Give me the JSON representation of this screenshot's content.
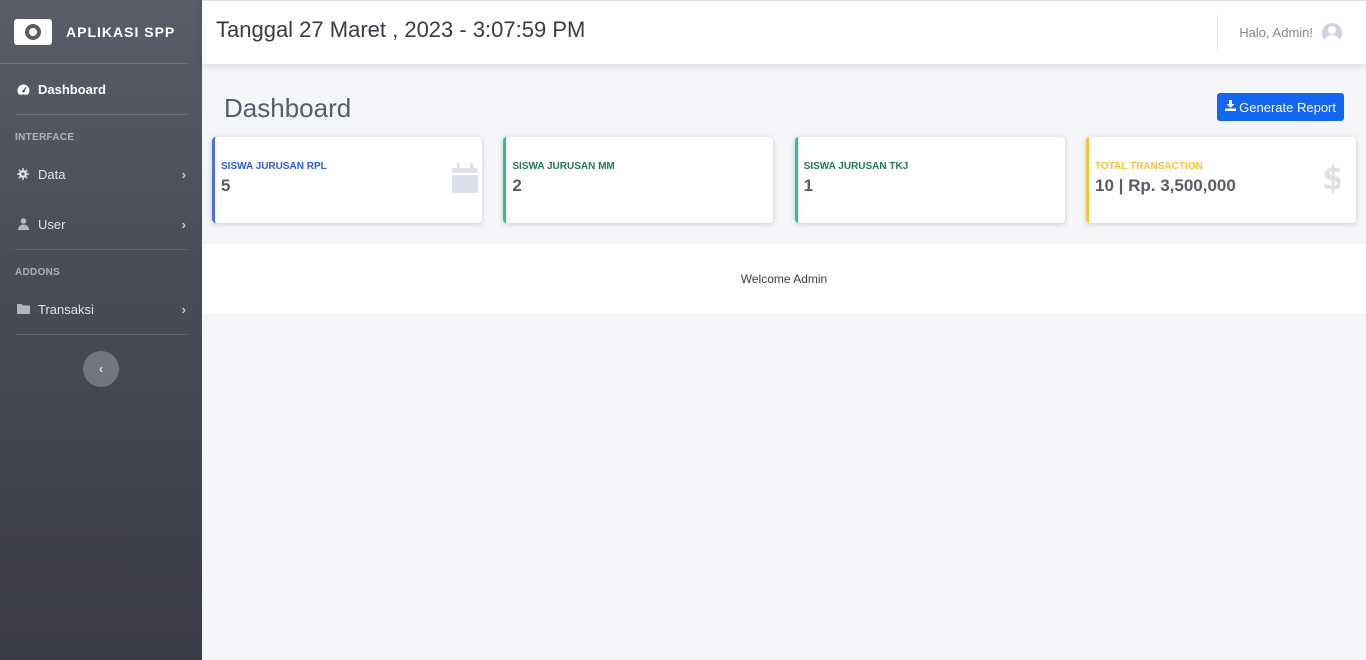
{
  "brand": {
    "title": "APLIKASI SPP"
  },
  "sidebar": {
    "dashboard_label": "Dashboard",
    "interface_heading": "INTERFACE",
    "data_label": "Data",
    "user_label": "User",
    "addons_heading": "ADDONS",
    "transaksi_label": "Transaksi",
    "chevron": "›",
    "toggle_glyph": "‹"
  },
  "topbar": {
    "datetime": "Tanggal 27 Maret , 2023 - 3:07:59 PM",
    "greeting": "Halo, Admin!"
  },
  "page": {
    "title": "Dashboard",
    "report_button": "Generate Report"
  },
  "cards": [
    {
      "label": "SISWA JURUSAN RPL",
      "value": "5",
      "color": "#2e59d9",
      "icon": "calendar-icon"
    },
    {
      "label": "SISWA JURUSAN MM",
      "value": "2",
      "color": "#1f7a4d",
      "icon": null
    },
    {
      "label": "SISWA JURUSAN TKJ",
      "value": "1",
      "color": "#1f7a4d",
      "icon": null
    },
    {
      "label": "TOTAL TRANSACTION",
      "value": "10 | Rp. 3,500,000",
      "color": "#f6c23e",
      "icon": "dollar-icon"
    }
  ],
  "welcome": {
    "text": "Welcome Admin"
  }
}
